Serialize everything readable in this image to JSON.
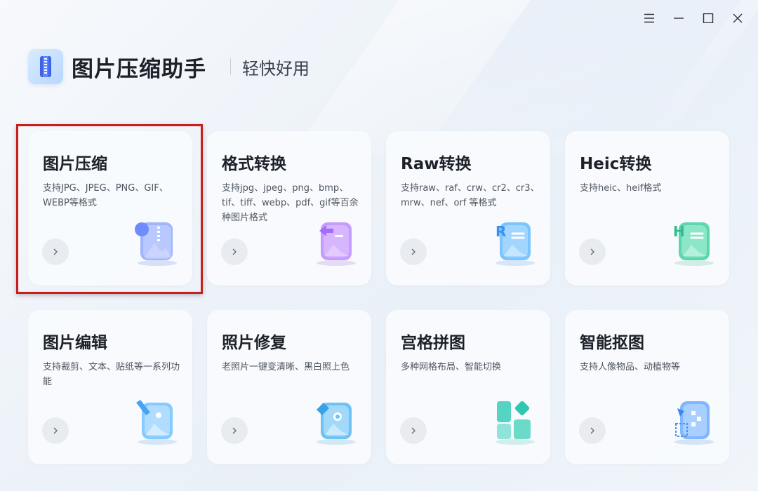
{
  "window": {
    "controls": [
      "menu-icon",
      "minimize-icon",
      "maximize-icon",
      "close-icon"
    ]
  },
  "header": {
    "title": "图片压缩助手",
    "subtitle": "轻快好用"
  },
  "cards": [
    {
      "title": "图片压缩",
      "desc": "支持JPG、JPEG、PNG、GIF、WEBP等格式",
      "icon": "zip-image-icon",
      "color": "#8fa8ff"
    },
    {
      "title": "格式转换",
      "desc": "支持jpg、jpeg、png、bmp、tif、tiff、webp、pdf、gif等百余种图片格式",
      "icon": "format-convert-icon",
      "color": "#c08bff"
    },
    {
      "title": "Raw转换",
      "desc": "支持raw、raf、crw、cr2、cr3、mrw、nef、orf 等格式",
      "icon": "raw-convert-icon",
      "color": "#5fb4ff"
    },
    {
      "title": "Heic转换",
      "desc": "支持heic、heif格式",
      "icon": "heic-convert-icon",
      "color": "#4fd6a8"
    },
    {
      "title": "图片编辑",
      "desc": "支持裁剪、文本、贴纸等一系列功能",
      "icon": "image-edit-icon",
      "color": "#6cc0ff"
    },
    {
      "title": "照片修复",
      "desc": "老照片一键变清晰、黑白照上色",
      "icon": "photo-repair-icon",
      "color": "#5ab8f5"
    },
    {
      "title": "宫格拼图",
      "desc": "多种网格布局、智能切换",
      "icon": "grid-collage-icon",
      "color": "#3fd0c0"
    },
    {
      "title": "智能抠图",
      "desc": "支持人像物品、动植物等",
      "icon": "smart-cutout-icon",
      "color": "#5fa8ff"
    }
  ]
}
